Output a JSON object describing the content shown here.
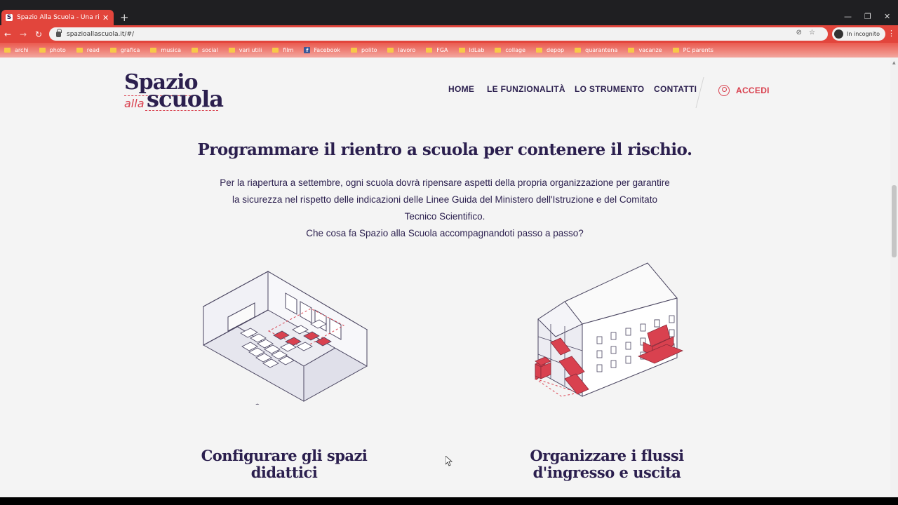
{
  "browser": {
    "tab_title": "Spazio Alla Scuola - Una risorsa",
    "tab_favicon": "S",
    "new_tab": "+",
    "url": "spazioallascuola.it/#/",
    "incognito_label": "In incognito",
    "window_controls": [
      "—",
      "❐",
      "✕"
    ],
    "nav_buttons": [
      "←",
      "→",
      "↻"
    ],
    "bookmarks": [
      {
        "label": "archi",
        "icon": "folder-icon"
      },
      {
        "label": "photo",
        "icon": "folder-icon"
      },
      {
        "label": "read",
        "icon": "folder-icon"
      },
      {
        "label": "grafica",
        "icon": "folder-icon"
      },
      {
        "label": "musica",
        "icon": "folder-icon"
      },
      {
        "label": "social",
        "icon": "folder-icon"
      },
      {
        "label": "vari utili",
        "icon": "folder-icon"
      },
      {
        "label": "film",
        "icon": "folder-icon"
      },
      {
        "label": "Facebook",
        "icon": "facebook-icon"
      },
      {
        "label": "polito",
        "icon": "folder-icon"
      },
      {
        "label": "lavoro",
        "icon": "folder-icon"
      },
      {
        "label": "FGA",
        "icon": "folder-icon"
      },
      {
        "label": "IdLab",
        "icon": "folder-icon"
      },
      {
        "label": "collage",
        "icon": "folder-icon"
      },
      {
        "label": "depop",
        "icon": "folder-icon"
      },
      {
        "label": "quarantena",
        "icon": "folder-icon"
      },
      {
        "label": "vacanze",
        "icon": "folder-icon"
      },
      {
        "label": "PC parents",
        "icon": "folder-icon"
      }
    ]
  },
  "site": {
    "logo": {
      "line1": "Spazio",
      "alla": "alla",
      "line2": "scuola"
    },
    "nav": [
      {
        "label": "HOME"
      },
      {
        "label": "LE FUNZIONALITÀ"
      },
      {
        "label": "LO STRUMENTO"
      },
      {
        "label": "CONTATTI"
      }
    ],
    "login_label": "ACCEDI",
    "hero_title": "Programmare il rientro a scuola per contenere il rischio.",
    "hero_lines": [
      "Per la riapertura a settembre, ogni scuola dovrà ripensare aspetti della propria organizzazione per garantire",
      "la sicurezza nel rispetto delle indicazioni delle Linee Guida del Ministero dell'Istruzione e del Comitato",
      "Tecnico Scientifico.",
      "Che cosa fa Spazio alla Scuola accompagnandoti passo a passo?"
    ],
    "features": [
      {
        "title_line1": "Configurare gli spazi",
        "title_line2": "didattici"
      },
      {
        "title_line1": "Organizzare i flussi",
        "title_line2": "d'ingresso e uscita"
      }
    ]
  },
  "colors": {
    "brand_navy": "#2b1f4e",
    "brand_red": "#d9414f",
    "browser_red": "#e2453c"
  }
}
